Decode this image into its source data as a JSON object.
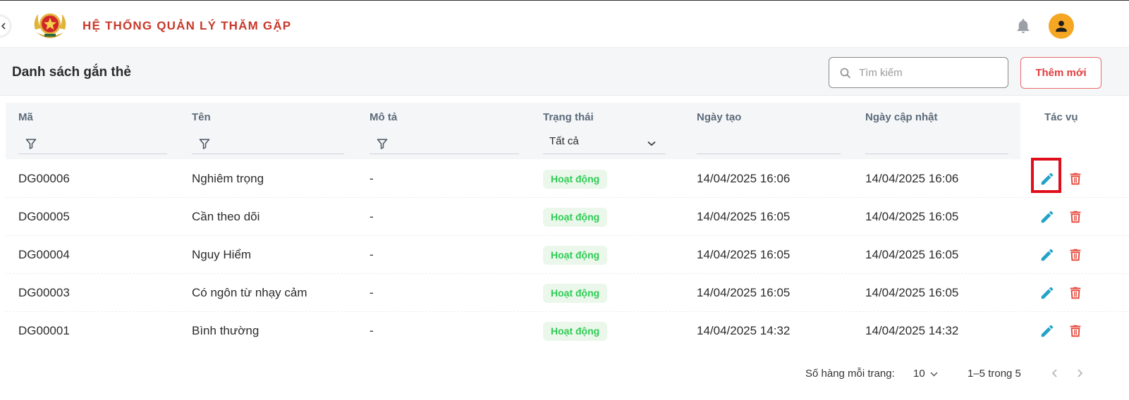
{
  "header": {
    "app_title": "HỆ THỐNG QUẢN LÝ THĂM GẶP",
    "icons": {
      "logo": "police-emblem-logo",
      "notifications": "bell-icon",
      "profile": "user-avatar-icon",
      "collapse": "chevron-left-icon"
    }
  },
  "toolbar": {
    "page_title": "Danh sách gắn thẻ",
    "search_placeholder": "Tìm kiếm",
    "add_label": "Thêm mới"
  },
  "table": {
    "columns": {
      "code": "Mã",
      "name": "Tên",
      "description": "Mô tả",
      "status": "Trạng thái",
      "created": "Ngày tạo",
      "updated": "Ngày cập nhật",
      "actions": "Tác vụ"
    },
    "status_filter_value": "Tất cả",
    "rows": [
      {
        "code": "DG00006",
        "name": "Nghiêm trọng",
        "description": "-",
        "status": "Hoạt động",
        "created": "14/04/2025 16:06",
        "updated": "14/04/2025 16:06"
      },
      {
        "code": "DG00005",
        "name": "Cần theo dõi",
        "description": "-",
        "status": "Hoạt động",
        "created": "14/04/2025 16:05",
        "updated": "14/04/2025 16:05"
      },
      {
        "code": "DG00004",
        "name": "Nguy Hiểm",
        "description": "-",
        "status": "Hoạt động",
        "created": "14/04/2025 16:05",
        "updated": "14/04/2025 16:05"
      },
      {
        "code": "DG00003",
        "name": "Có ngôn từ nhạy cảm",
        "description": "-",
        "status": "Hoạt động",
        "created": "14/04/2025 16:05",
        "updated": "14/04/2025 16:05"
      },
      {
        "code": "DG00001",
        "name": "Bình thường",
        "description": "-",
        "status": "Hoạt động",
        "created": "14/04/2025 14:32",
        "updated": "14/04/2025 14:32"
      }
    ]
  },
  "pagination": {
    "rows_per_page_label": "Số hàng mỗi trang:",
    "rows_per_page": "10",
    "range": "1–5 trong 5"
  },
  "colors": {
    "brand_red": "#c8392b",
    "accent_red": "#e23c3c",
    "status_green": "#2ecc55",
    "edit_teal": "#1fa3c6",
    "highlight_red": "#e00d1b",
    "avatar_orange": "#f5a623"
  }
}
